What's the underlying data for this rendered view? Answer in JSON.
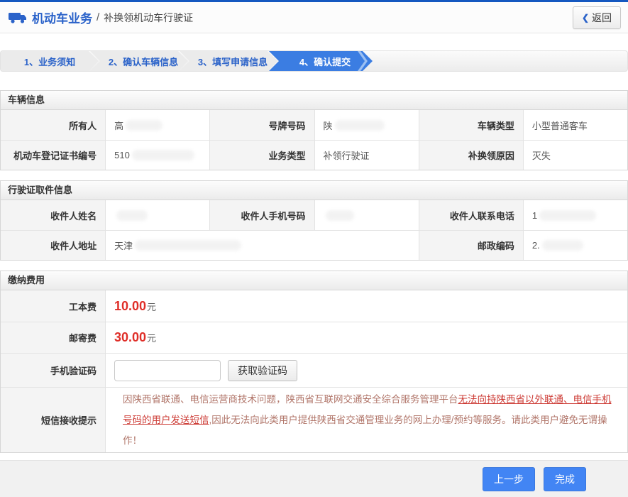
{
  "header": {
    "title": "机动车业务",
    "separator": "/",
    "subtitle": "补换领机动车行驶证",
    "back_chevron": "❮",
    "back_label": "返回",
    "truck_icon": "truck-icon",
    "accent_color": "#2a62c9"
  },
  "steps": [
    {
      "label": "1、业务须知",
      "active": false
    },
    {
      "label": "2、确认车辆信息",
      "active": false
    },
    {
      "label": "3、填写申请信息",
      "active": false
    },
    {
      "label": "4、确认提交",
      "active": true
    }
  ],
  "vehicle_info": {
    "title": "车辆信息",
    "owner": {
      "label": "所有人",
      "value": "高"
    },
    "plate": {
      "label": "号牌号码",
      "value": "陕"
    },
    "vehicle_type": {
      "label": "车辆类型",
      "value": "小型普通客车"
    },
    "registration_no": {
      "label": "机动车登记证书编号",
      "value": "510"
    },
    "business_type": {
      "label": "业务类型",
      "value": "补领行驶证"
    },
    "replace_reason": {
      "label": "补换领原因",
      "value": "灭失"
    }
  },
  "pickup_info": {
    "title": "行驶证取件信息",
    "recipient_name": {
      "label": "收件人姓名",
      "value": ""
    },
    "recipient_mobile": {
      "label": "收件人手机号码",
      "value": ""
    },
    "recipient_phone": {
      "label": "收件人联系电话",
      "value": "1"
    },
    "recipient_address": {
      "label": "收件人地址",
      "value": "天津"
    },
    "postal_code": {
      "label": "邮政编码",
      "value": "2."
    }
  },
  "fees": {
    "title": "缴纳费用",
    "production_fee": {
      "label": "工本费",
      "amount": "10.00",
      "unit": "元"
    },
    "postage_fee": {
      "label": "邮寄费",
      "amount": "30.00",
      "unit": "元"
    },
    "sms_code": {
      "label": "手机验证码",
      "input_value": "",
      "button_label": "获取验证码"
    },
    "sms_notice": {
      "label": "短信接收提示",
      "text_part1": "因陕西省联通、电信运营商技术问题，陕西省互联网交通安全综合服务管理平台",
      "text_part2": "无法向持陕西省以外联通、电信手机号码的用户发送短信",
      "text_part3": ",因此无法向此类用户提供陕西省交通管理业务的网上办理/预约等服务。请此类用户避免无谓操作！"
    },
    "amount_color": "#df2e28"
  },
  "footer": {
    "prev_label": "上一步",
    "finish_label": "完成",
    "button_color": "#4285f4"
  }
}
